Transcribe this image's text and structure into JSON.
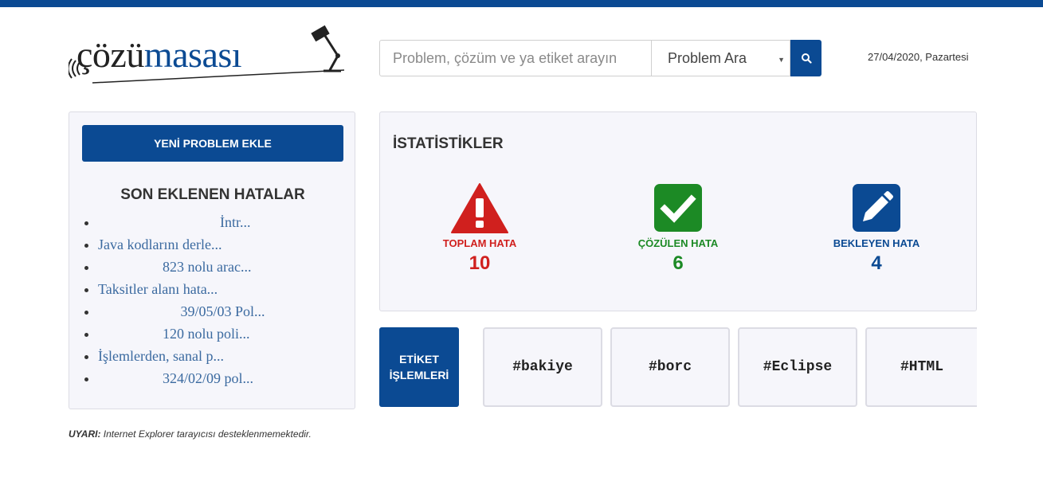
{
  "colors": {
    "brand": "#0b4a93",
    "danger": "#d0201e",
    "success": "#1c8a25",
    "warning_label": "#0b4a93"
  },
  "logo": {
    "part1": "çözü",
    "part2": "masası",
    "icon": "desk-lamp-icon"
  },
  "search": {
    "placeholder": "Problem, çözüm ve ya etiket arayın",
    "select_value": "Problem Ara",
    "button_icon": "search-icon"
  },
  "date": "27/04/2020, Pazartesi",
  "sidebar": {
    "new_button": "YENİ PROBLEM EKLE",
    "title": "SON EKLENEN HATALAR",
    "items": [
      "                                  İntr...",
      "Java kodlarını derle...",
      "                  823 nolu arac...",
      "Taksitler alanı hata...",
      "                       39/05/03 Pol...",
      "                  120 nolu poli...",
      "İşlemlerden, sanal p...",
      "                  324/02/09 pol..."
    ]
  },
  "warning": {
    "label": "UYARI:",
    "text": " Internet Explorer tarayıcısı desteklenmemektedir."
  },
  "stats": {
    "title": "İSTATİSTİKLER",
    "total": {
      "label": "TOPLAM HATA",
      "value": "10",
      "icon": "warning-triangle-icon"
    },
    "solved": {
      "label": "ÇÖZÜLEN HATA",
      "value": "6",
      "icon": "check-icon"
    },
    "pending": {
      "label": "BEKLEYEN HATA",
      "value": "4",
      "icon": "pencil-icon"
    }
  },
  "tags": {
    "label_line1": "ETİKET",
    "label_line2": "İŞLEMLERİ",
    "items": [
      "#bakiye",
      "#borc",
      "#Eclipse",
      "#HTML"
    ]
  }
}
